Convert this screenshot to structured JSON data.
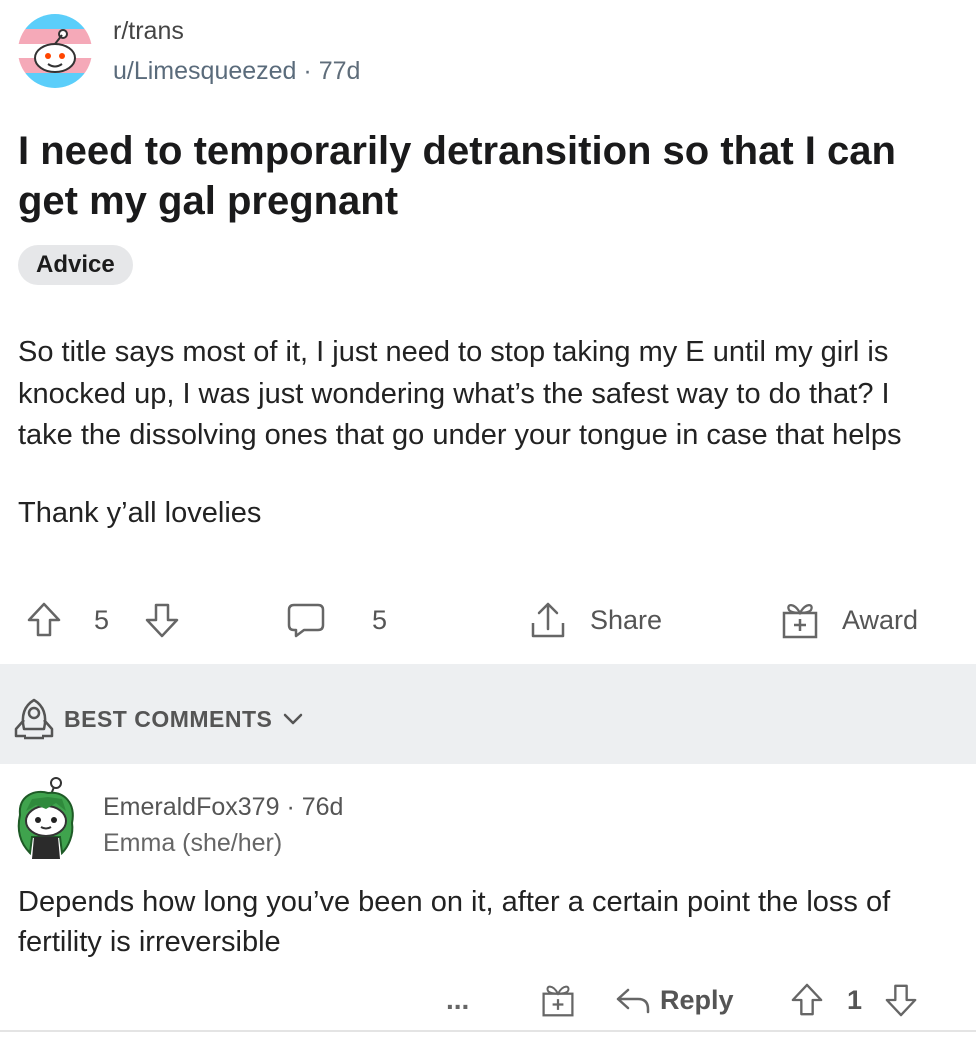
{
  "post": {
    "subreddit": "r/trans",
    "author": "u/Limesqueezed",
    "age": "77d",
    "title": "I need to temporarily detransition so that I can get my gal pregnant",
    "flair": "Advice",
    "body": [
      "So title says most of it, I just need to stop taking my E until my girl is knocked up, I was just wondering what’s the safest way to do that? I take the dissolving ones that go under your tongue in case that helps",
      "Thank y’all lovelies"
    ],
    "score": "5",
    "comment_count": "5",
    "share_label": "Share",
    "award_label": "Award"
  },
  "sort": {
    "label": "BEST COMMENTS"
  },
  "comment": {
    "author": "EmeraldFox379",
    "age": "76d",
    "user_flair": "Emma (she/her)",
    "text": "Depends how long you’ve been on it, after a certain point the loss of fertility is irreversible",
    "more_label": "...",
    "reply_label": "Reply",
    "score": "1"
  },
  "icons": {
    "subreddit_avatar": "snoo-trans-flag-icon",
    "upvote": "arrow-up-icon",
    "downvote": "arrow-down-icon",
    "comments": "comment-bubble-icon",
    "share": "share-icon",
    "award": "gift-icon",
    "sort": "rocket-icon",
    "chevron": "chevron-down-icon",
    "reply": "reply-arrow-icon"
  },
  "colors": {
    "flag_blue": "#5bcefa",
    "flag_pink": "#f5a9b8",
    "meta": "#5f6d7a",
    "band": "#edeff1"
  }
}
